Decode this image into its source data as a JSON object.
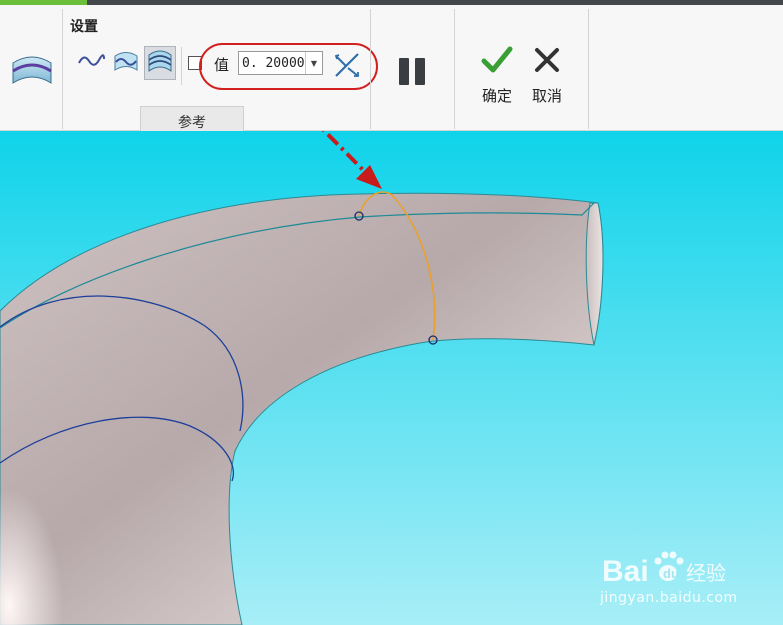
{
  "ribbon": {
    "group_title": "设置",
    "value_label": "值",
    "value_input": "0. 20000",
    "reference_tab": "参考",
    "confirm_label": "确定",
    "cancel_label": "取消"
  },
  "watermark": {
    "brand": "Bai",
    "brand_suffix": "经验",
    "url": "jingyan.baidu.com"
  },
  "colors": {
    "viewport_top": "#0fd3ea",
    "viewport_bottom": "#a8eef7",
    "highlight": "#d2201f",
    "confirm_check": "#3aa036",
    "part_surface": "#d9cccc"
  },
  "icons": [
    "sweep-feature-icon",
    "curve-icon",
    "surface-curve-icon",
    "surface-icon",
    "flip-direction-icon",
    "pause-icon",
    "checkmark-icon",
    "close-icon"
  ]
}
